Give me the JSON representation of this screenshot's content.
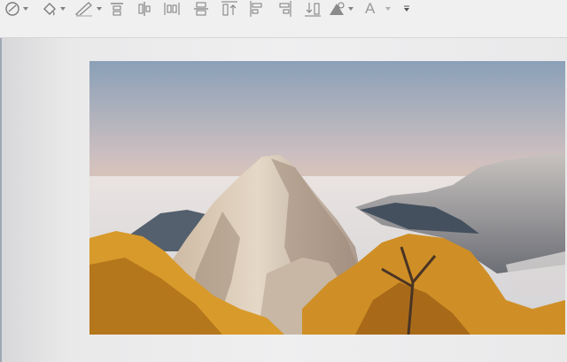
{
  "toolbar": {
    "icons": [
      "shape-fill-icon",
      "fill-bucket-icon",
      "pen-outline-icon",
      "align-top-icon",
      "align-center-vertical-icon",
      "distribute-horizontal-icon",
      "align-middle-icon",
      "align-bottom-up-icon",
      "align-left-icon",
      "align-right-icon",
      "bring-down-icon",
      "effects-icon",
      "text-format-icon",
      "more-dropdown-icon"
    ],
    "text_format_glyph": "A"
  },
  "slide": {
    "image_subject": "mountain-landscape-photo",
    "colors": {
      "sky_top": "#8aa0b8",
      "sky_glow": "#f6cfa3",
      "rock": "#d8c8b4",
      "foliage": "#d89a2a"
    }
  }
}
